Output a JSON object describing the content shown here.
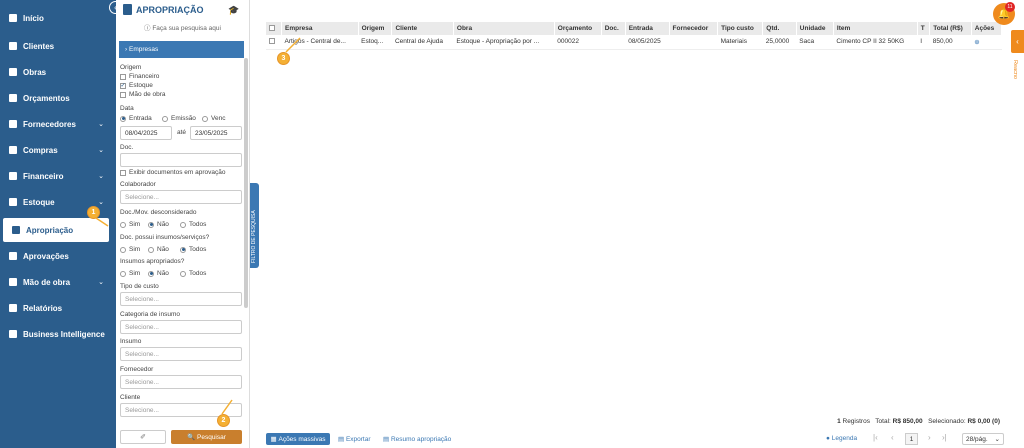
{
  "sidebar": {
    "items": [
      {
        "label": "Início",
        "icon": "home-icon",
        "chevron": false
      },
      {
        "label": "Clientes",
        "icon": "user-icon",
        "chevron": false
      },
      {
        "label": "Obras",
        "icon": "building-icon",
        "chevron": false
      },
      {
        "label": "Orçamentos",
        "icon": "calculator-icon",
        "chevron": false
      },
      {
        "label": "Fornecedores",
        "icon": "truck-icon",
        "chevron": true
      },
      {
        "label": "Compras",
        "icon": "cart-icon",
        "chevron": true
      },
      {
        "label": "Financeiro",
        "icon": "dollar-icon",
        "chevron": true
      },
      {
        "label": "Estoque",
        "icon": "box-icon",
        "chevron": true
      },
      {
        "label": "Apropriação",
        "icon": "document-icon",
        "chevron": false,
        "active": true
      },
      {
        "label": "Aprovações",
        "icon": "check-icon",
        "chevron": false
      },
      {
        "label": "Mão de obra",
        "icon": "workers-icon",
        "chevron": true
      },
      {
        "label": "Relatórios",
        "icon": "report-icon",
        "chevron": false
      },
      {
        "label": "Business Intelligence",
        "icon": "chart-icon",
        "chevron": false
      }
    ]
  },
  "filter": {
    "title": "APROPRIAÇÃO",
    "search_hint": "Faça sua pesquisa aqui",
    "empresas": "Empresas",
    "origem_label": "Origem",
    "origem_options": [
      {
        "label": "Financeiro",
        "checked": false
      },
      {
        "label": "Estoque",
        "checked": true
      },
      {
        "label": "Mão de obra",
        "checked": false
      }
    ],
    "data_label": "Data",
    "data_options": [
      {
        "label": "Entrada",
        "checked": true
      },
      {
        "label": "Emissão",
        "checked": false
      },
      {
        "label": "Venc",
        "checked": false
      }
    ],
    "date_from": "08/04/2025",
    "ate": "até",
    "date_to": "23/05/2025",
    "doc_label": "Doc.",
    "exibir_label": "Exibir documentos em aprovação",
    "colaborador_label": "Colaborador",
    "select_placeholder": "Selecione...",
    "desconsiderado_label": "Doc./Mov. desconsiderado",
    "insumos_label": "Doc. possui insumos/serviços?",
    "apropriados_label": "Insumos apropriados?",
    "sim": "Sim",
    "nao": "Não",
    "todos": "Todos",
    "tipo_custo_label": "Tipo de custo",
    "categoria_label": "Categoria de insumo",
    "insumo_label": "Insumo",
    "fornecedor_label": "Fornecedor",
    "cliente_label": "Cliente",
    "search_button": "Pesquisar",
    "tab_label": "FILTRO DE PESQUISA"
  },
  "table": {
    "columns": [
      "Empresa",
      "Origem",
      "Cliente",
      "Obra",
      "Orçamento",
      "Doc.",
      "Entrada",
      "Fornecedor",
      "Tipo custo",
      "Qtd.",
      "Unidade",
      "Item",
      "T",
      "Total (R$)",
      "Ações"
    ],
    "rows": [
      [
        "Artigos - Central de...",
        "Estoq...",
        "Central de Ajuda",
        "Estoque - Apropriação por ...",
        "000022",
        "",
        "08/05/2025",
        "",
        "Materiais",
        "25,0000",
        "Saca",
        "Cimento CP II 32 50KG",
        "I",
        "850,00",
        ""
      ]
    ]
  },
  "stats": {
    "registros_count": "1",
    "registros_label": "Registros",
    "total_label": "Total:",
    "total_value": "R$ 850,00",
    "selecionado_label": "Selecionado:",
    "selecionado_value": "R$ 0,00 (0)"
  },
  "bottom": {
    "acoes_massivas": "Ações massivas",
    "exportar": "Exportar",
    "resumo": "Resumo apropriação",
    "legenda": "Legenda",
    "page": "1",
    "per_page": "28/pág."
  },
  "notifications": {
    "count": "11"
  },
  "right_tab": {
    "label": "Reacno"
  },
  "markers": [
    "1",
    "2",
    "3"
  ],
  "colors": {
    "sidebar": "#2b5d8c",
    "accent": "#3b78b3",
    "search_button": "#c97f2d",
    "marker": "#f4b034",
    "bell": "#ef8a1d"
  }
}
